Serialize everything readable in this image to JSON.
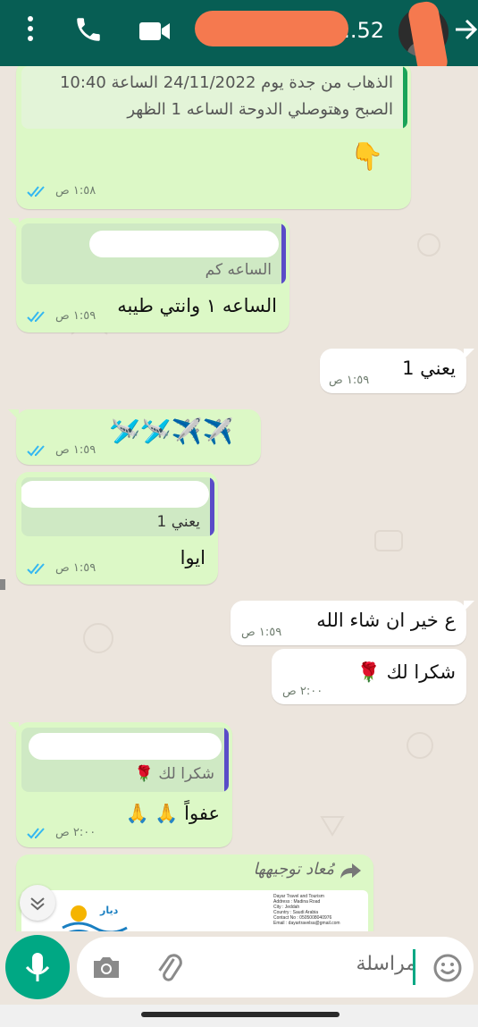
{
  "header": {
    "contact_name": "...52",
    "icons": [
      "more-vertical-icon",
      "phone-call-icon",
      "video-call-icon",
      "back-arrow-icon"
    ],
    "bar_color": "#075e54"
  },
  "messages": [
    {
      "side": "sent",
      "text_line1": "الذهاب من جدة  يوم 24/11/2022 الساعة 10:40",
      "text_line2": "الصبح وهتوصلي الدوحة الساعه 1 الظهر",
      "emoji": "👇",
      "time": "١:٥٨ ص"
    },
    {
      "side": "sent",
      "quote": "الساعه كم",
      "text": "الساعه ١ وانتي طيبه",
      "time": "١:٥٩ ص"
    },
    {
      "side": "received",
      "text": "يعني 1",
      "time": "١:٥٩ ص"
    },
    {
      "side": "sent",
      "emoji": "🛩️🛩️✈️✈️",
      "time": "١:٥٩ ص"
    },
    {
      "side": "sent",
      "quote": "يعني 1",
      "text": "ايوا",
      "time": "١:٥٩ ص"
    },
    {
      "side": "received",
      "text": "ع خير ان شاء الله",
      "time": "١:٥٩ ص"
    },
    {
      "side": "received",
      "text": "شكرا لك 🌹",
      "time": "٢:٠٠ ص"
    },
    {
      "side": "sent",
      "quote": "شكرا لك 🌹",
      "text": "عفواً 🙏 🙏",
      "time": "٢:٠٠ ص"
    },
    {
      "side": "sent",
      "forward_label": "مُعاد توجيهها",
      "doc_lines": [
        "Dayar Travel and Tourism",
        "Address : Madina Road",
        "City : Jeddah",
        "Country : Saudi Arabia",
        "Contact No : 0505008040976",
        "Email : dayartravelsa@gmail.com"
      ],
      "logo_text": "ديار"
    }
  ],
  "composer": {
    "placeholder": "مراسلة",
    "icons": [
      "emoji-icon",
      "attach-icon",
      "camera-icon",
      "mic-icon",
      "scroll-down-icon"
    ]
  },
  "colors": {
    "sent_bubble": "#dcf8c6",
    "received_bubble": "#ffffff",
    "quote_bar_green": "#1aa358",
    "quote_bar_purple": "#5a4cc8",
    "accent": "#00a884"
  }
}
